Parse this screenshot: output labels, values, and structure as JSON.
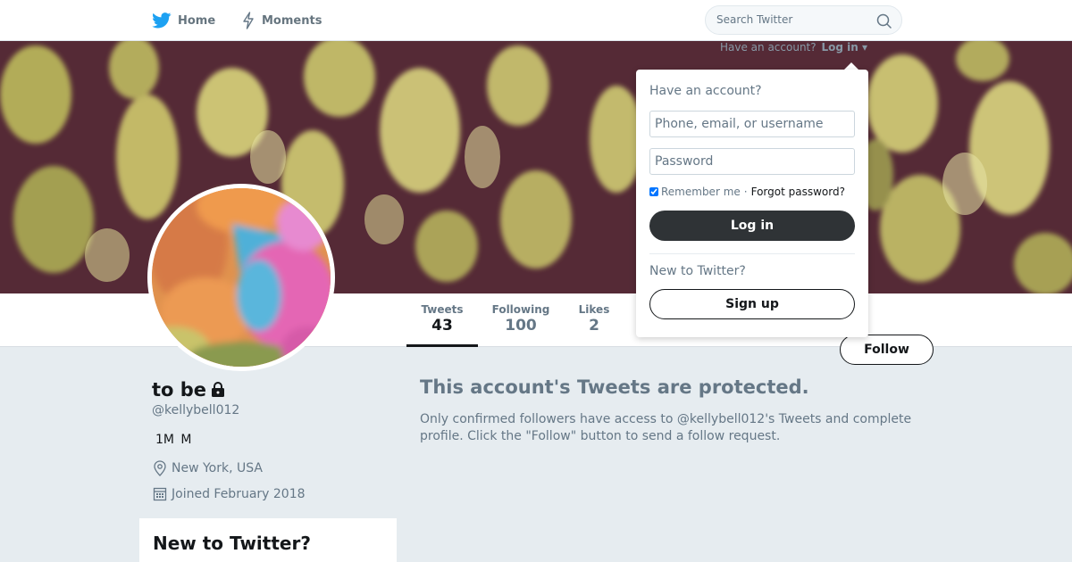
{
  "nav": {
    "home_label": "Home",
    "moments_label": "Moments",
    "search_placeholder": "Search Twitter",
    "brand_color": "#1da1f2"
  },
  "banner": {
    "login_prompt": "Have an account?",
    "login_link": "Log in"
  },
  "stats": [
    {
      "label": "Tweets",
      "value": "43"
    },
    {
      "label": "Following",
      "value": "100"
    },
    {
      "label": "Likes",
      "value": "2"
    }
  ],
  "follow_label": "Follow",
  "profile": {
    "name": "to be",
    "handle": "@kellybell012",
    "bio": "1M M",
    "location": "New York, USA",
    "joined": "Joined February 2018"
  },
  "protected": {
    "title": "This account's Tweets are protected.",
    "body": "Only confirmed followers have access to @kellybell012's Tweets and complete profile. Click the \"Follow\" button to send a follow request."
  },
  "login_dropdown": {
    "heading": "Have an account?",
    "username_placeholder": "Phone, email, or username",
    "password_placeholder": "Password",
    "remember_label": "Remember me",
    "separator": "·",
    "forgot_label": "Forgot password?",
    "login_button": "Log in",
    "new_label": "New to Twitter?",
    "signup_button": "Sign up"
  },
  "sidebar_module": {
    "title": "New to Twitter?"
  },
  "icons": [
    "twitter-bird-icon",
    "lightning-icon",
    "search-icon",
    "lock-icon",
    "location-pin-icon",
    "calendar-icon",
    "chevron-down-icon"
  ]
}
